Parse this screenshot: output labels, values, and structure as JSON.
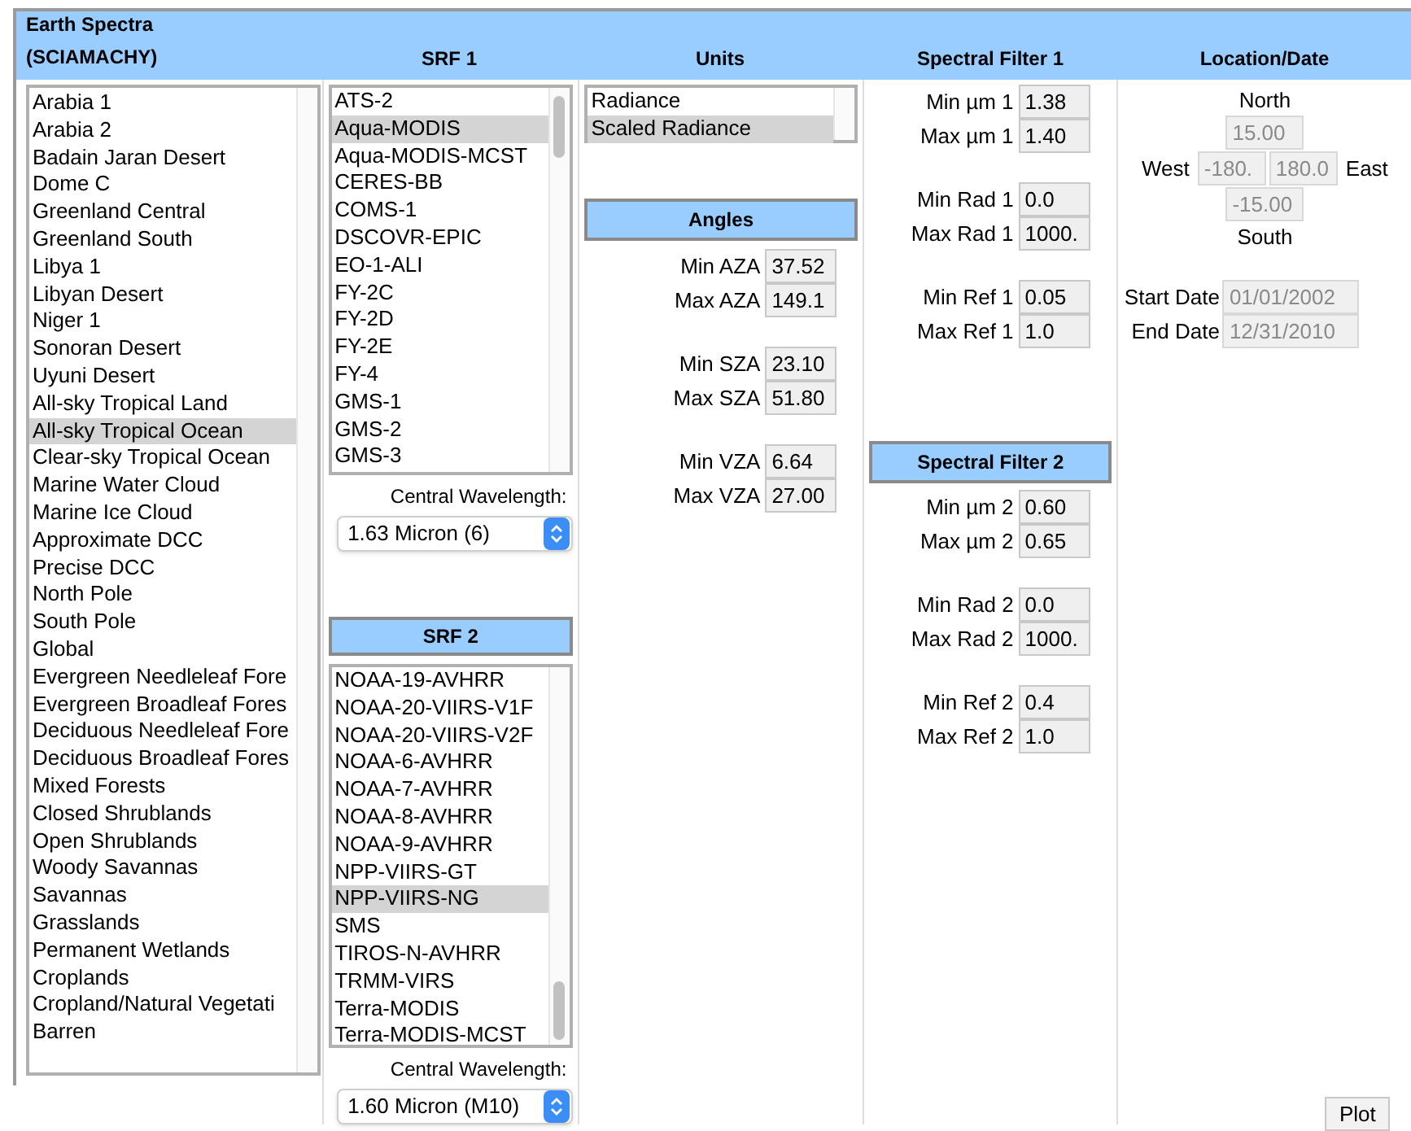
{
  "header": {
    "title": "Earth Spectra (SCIAMACHY)",
    "columns": [
      "SRF 1",
      "Units",
      "Spectral Filter 1",
      "Location/Date"
    ]
  },
  "sites": [
    {
      "label": "Arabia 1",
      "selected": false
    },
    {
      "label": "Arabia 2",
      "selected": false
    },
    {
      "label": "Badain Jaran Desert",
      "selected": false
    },
    {
      "label": "Dome C",
      "selected": false
    },
    {
      "label": "Greenland Central",
      "selected": false
    },
    {
      "label": "Greenland South",
      "selected": false
    },
    {
      "label": "Libya 1",
      "selected": false
    },
    {
      "label": "Libyan Desert",
      "selected": false
    },
    {
      "label": "Niger 1",
      "selected": false
    },
    {
      "label": "Sonoran Desert",
      "selected": false
    },
    {
      "label": "Uyuni Desert",
      "selected": false
    },
    {
      "label": "All-sky Tropical Land",
      "selected": false
    },
    {
      "label": "All-sky Tropical Ocean",
      "selected": true
    },
    {
      "label": "Clear-sky Tropical Ocean",
      "selected": false
    },
    {
      "label": "Marine Water Cloud",
      "selected": false
    },
    {
      "label": "Marine Ice Cloud",
      "selected": false
    },
    {
      "label": "Approximate DCC",
      "selected": false
    },
    {
      "label": "Precise DCC",
      "selected": false
    },
    {
      "label": "North Pole",
      "selected": false
    },
    {
      "label": "South Pole",
      "selected": false
    },
    {
      "label": "Global",
      "selected": false
    },
    {
      "label": "Evergreen Needleleaf Fore",
      "selected": false
    },
    {
      "label": "Evergreen Broadleaf Fores",
      "selected": false
    },
    {
      "label": "Deciduous Needleleaf Fore",
      "selected": false
    },
    {
      "label": "Deciduous Broadleaf Fores",
      "selected": false
    },
    {
      "label": "Mixed Forests",
      "selected": false
    },
    {
      "label": "Closed Shrublands",
      "selected": false
    },
    {
      "label": "Open Shrublands",
      "selected": false
    },
    {
      "label": "Woody Savannas",
      "selected": false
    },
    {
      "label": "Savannas",
      "selected": false
    },
    {
      "label": "Grasslands",
      "selected": false
    },
    {
      "label": "Permanent Wetlands",
      "selected": false
    },
    {
      "label": "Croplands",
      "selected": false
    },
    {
      "label": "Cropland/Natural Vegetati",
      "selected": false
    },
    {
      "label": "Barren",
      "selected": false
    }
  ],
  "srf1": {
    "items": [
      {
        "label": "ATS-2",
        "selected": false
      },
      {
        "label": "Aqua-MODIS",
        "selected": true
      },
      {
        "label": "Aqua-MODIS-MCST",
        "selected": false
      },
      {
        "label": "CERES-BB",
        "selected": false
      },
      {
        "label": "COMS-1",
        "selected": false
      },
      {
        "label": "DSCOVR-EPIC",
        "selected": false
      },
      {
        "label": "EO-1-ALI",
        "selected": false
      },
      {
        "label": "FY-2C",
        "selected": false
      },
      {
        "label": "FY-2D",
        "selected": false
      },
      {
        "label": "FY-2E",
        "selected": false
      },
      {
        "label": "FY-4",
        "selected": false
      },
      {
        "label": "GMS-1",
        "selected": false
      },
      {
        "label": "GMS-2",
        "selected": false
      },
      {
        "label": "GMS-3",
        "selected": false
      }
    ],
    "wavelength_label": "Central Wavelength:",
    "wavelength": "1.63 Micron (6)"
  },
  "srf2": {
    "title": "SRF 2",
    "items": [
      {
        "label": "NOAA-19-AVHRR",
        "selected": false
      },
      {
        "label": "NOAA-20-VIIRS-V1F",
        "selected": false
      },
      {
        "label": "NOAA-20-VIIRS-V2F",
        "selected": false
      },
      {
        "label": "NOAA-6-AVHRR",
        "selected": false
      },
      {
        "label": "NOAA-7-AVHRR",
        "selected": false
      },
      {
        "label": "NOAA-8-AVHRR",
        "selected": false
      },
      {
        "label": "NOAA-9-AVHRR",
        "selected": false
      },
      {
        "label": "NPP-VIIRS-GT",
        "selected": false
      },
      {
        "label": "NPP-VIIRS-NG",
        "selected": true
      },
      {
        "label": "SMS",
        "selected": false
      },
      {
        "label": "TIROS-N-AVHRR",
        "selected": false
      },
      {
        "label": "TRMM-VIRS",
        "selected": false
      },
      {
        "label": "Terra-MODIS",
        "selected": false
      },
      {
        "label": "Terra-MODIS-MCST",
        "selected": false
      }
    ],
    "wavelength_label": "Central Wavelength:",
    "wavelength": "1.60 Micron (M10)"
  },
  "units": [
    {
      "label": "Radiance",
      "selected": false
    },
    {
      "label": "Scaled Radiance",
      "selected": true
    }
  ],
  "angles": {
    "title": "Angles",
    "groups": [
      [
        {
          "label": "Min AZA",
          "value": "37.52"
        },
        {
          "label": "Max AZA",
          "value": "149.1"
        }
      ],
      [
        {
          "label": "Min SZA",
          "value": "23.10"
        },
        {
          "label": "Max SZA",
          "value": "51.80"
        }
      ],
      [
        {
          "label": "Min VZA",
          "value": "6.64"
        },
        {
          "label": "Max VZA",
          "value": "27.00"
        }
      ]
    ]
  },
  "filter1": {
    "groups": [
      [
        {
          "label": "Min µm 1",
          "value": "1.38"
        },
        {
          "label": "Max µm 1",
          "value": "1.40"
        }
      ],
      [
        {
          "label": "Min Rad 1",
          "value": "0.0"
        },
        {
          "label": "Max Rad 1",
          "value": "1000."
        }
      ],
      [
        {
          "label": "Min Ref 1",
          "value": "0.05"
        },
        {
          "label": "Max Ref 1",
          "value": "1.0"
        }
      ]
    ]
  },
  "filter2": {
    "title": "Spectral Filter 2",
    "groups": [
      [
        {
          "label": "Min µm 2",
          "value": "0.60"
        },
        {
          "label": "Max µm 2",
          "value": "0.65"
        }
      ],
      [
        {
          "label": "Min Rad 2",
          "value": "0.0"
        },
        {
          "label": "Max Rad 2",
          "value": "1000."
        }
      ],
      [
        {
          "label": "Min Ref 2",
          "value": "0.4"
        },
        {
          "label": "Max Ref 2",
          "value": "1.0"
        }
      ]
    ]
  },
  "location": {
    "north_label": "North",
    "north": "15.00",
    "west_label": "West",
    "west": "-180.",
    "east": "180.0",
    "east_label": "East",
    "south": "-15.00",
    "south_label": "South",
    "disabled": true,
    "dates": [
      {
        "label": "Start Date",
        "value": "01/01/2002"
      },
      {
        "label": "End Date",
        "value": "12/31/2010"
      }
    ]
  },
  "plot_button": "Plot"
}
